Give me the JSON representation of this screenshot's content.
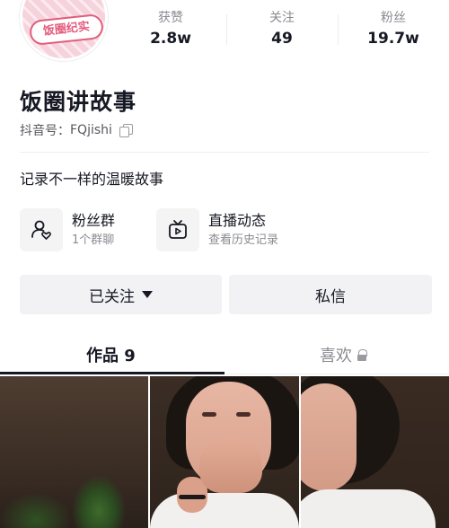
{
  "profile": {
    "avatar_text": "饭圈纪实",
    "name": "饭圈讲故事",
    "uid_label": "抖音号：",
    "uid": "FQjishi",
    "bio": "记录不一样的温暖故事"
  },
  "stats": [
    {
      "label": "获赞",
      "value": "2.8w"
    },
    {
      "label": "关注",
      "value": "49"
    },
    {
      "label": "粉丝",
      "value": "19.7w"
    }
  ],
  "features": [
    {
      "title": "粉丝群",
      "sub": "1个群聊",
      "icon": "fan-group-icon"
    },
    {
      "title": "直播动态",
      "sub": "查看历史记录",
      "icon": "tv-play-icon"
    }
  ],
  "actions": {
    "followed_label": "已关注",
    "message_label": "私信"
  },
  "tabs": {
    "works_label": "作品 9",
    "likes_label": "喜欢"
  }
}
